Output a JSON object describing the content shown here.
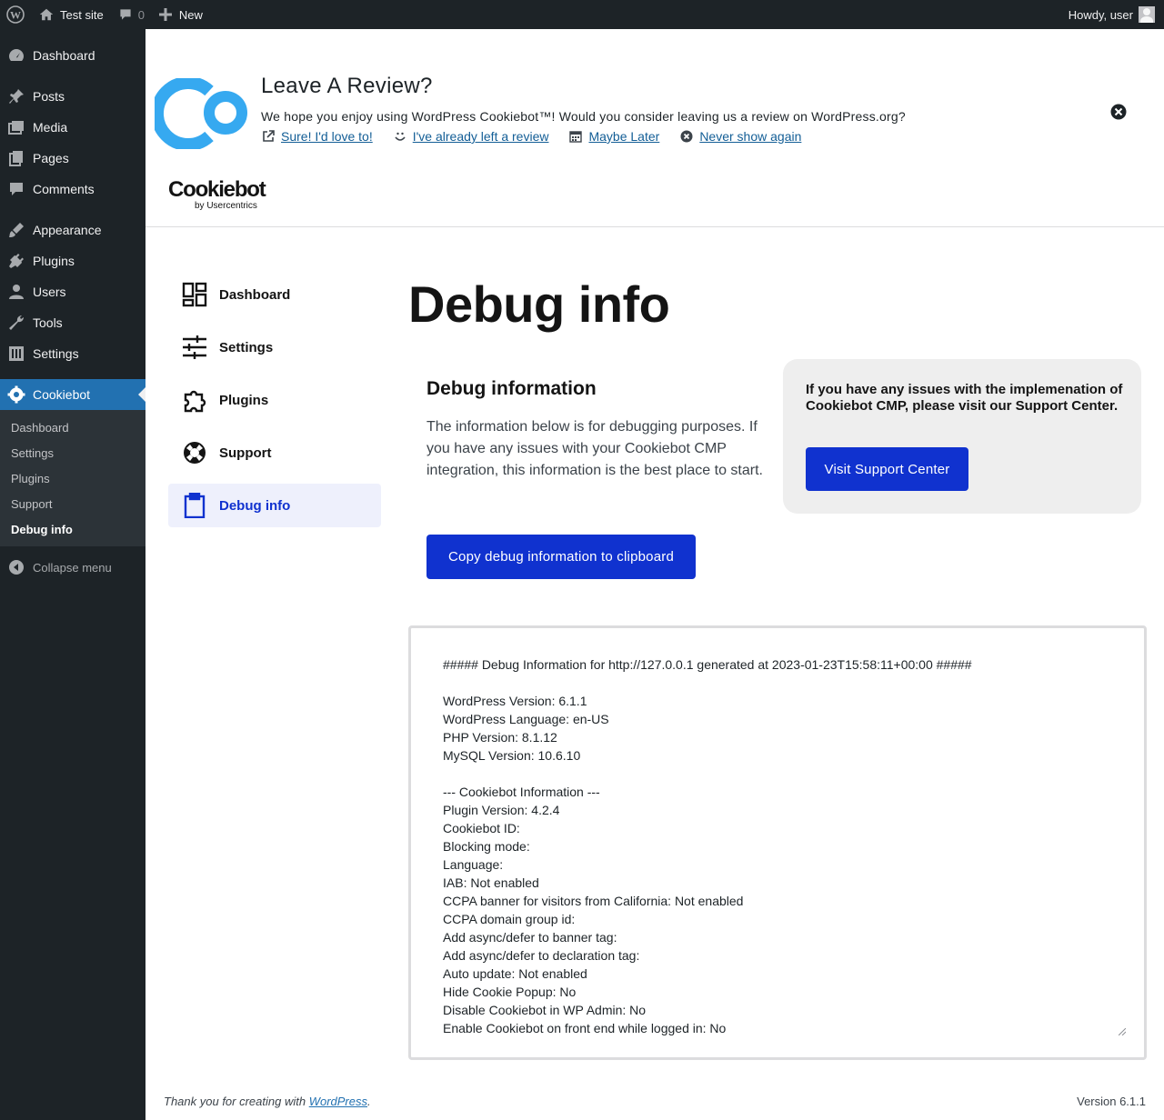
{
  "adminbar": {
    "site_name": "Test site",
    "comments_count": "0",
    "new_label": "New",
    "howdy": "Howdy, user"
  },
  "sidebar": {
    "items": [
      {
        "label": "Dashboard",
        "icon": "dashboard-icon"
      },
      {
        "label": "Posts",
        "icon": "pin-icon"
      },
      {
        "label": "Media",
        "icon": "media-icon"
      },
      {
        "label": "Pages",
        "icon": "pages-icon"
      },
      {
        "label": "Comments",
        "icon": "comment-icon"
      },
      {
        "label": "Appearance",
        "icon": "brush-icon"
      },
      {
        "label": "Plugins",
        "icon": "plug-icon"
      },
      {
        "label": "Users",
        "icon": "user-icon"
      },
      {
        "label": "Tools",
        "icon": "wrench-icon"
      },
      {
        "label": "Settings",
        "icon": "settings-icon"
      },
      {
        "label": "Cookiebot",
        "icon": "gear-icon"
      }
    ],
    "submenu": [
      "Dashboard",
      "Settings",
      "Plugins",
      "Support",
      "Debug info"
    ],
    "collapse_label": "Collapse menu"
  },
  "review": {
    "title": "Leave A Review?",
    "text": "We hope you enjoy using WordPress Cookiebot™! Would you consider leaving us a review on WordPress.org?",
    "links": [
      "Sure! I'd love to!",
      "I've already left a review",
      "Maybe Later",
      "Never show again"
    ]
  },
  "brand": {
    "name": "Cookiebot",
    "sub": "by Usercentrics"
  },
  "cb_nav": [
    "Dashboard",
    "Settings",
    "Plugins",
    "Support",
    "Debug info"
  ],
  "page_title": "Debug info",
  "debug": {
    "heading": "Debug information",
    "description": "The information below is for debugging purposes. If you have any issues with your Cookiebot CMP integration, this information is the best place to start.",
    "copy_button": "Copy debug information to clipboard",
    "lines": [
      "##### Debug Information for http://127.0.0.1 generated at 2023-01-23T15:58:11+00:00 #####",
      "",
      "WordPress Version: 6.1.1",
      "WordPress Language: en-US",
      "PHP Version: 8.1.12",
      "MySQL Version: 10.6.10",
      "",
      "--- Cookiebot Information ---",
      "Plugin Version: 4.2.4",
      "Cookiebot ID:",
      "Blocking mode:",
      "Language:",
      "IAB: Not enabled",
      "CCPA banner for visitors from California: Not enabled",
      "CCPA domain group id:",
      "Add async/defer to banner tag:",
      "Add async/defer to declaration tag:",
      "Auto update: Not enabled",
      "Hide Cookie Popup: No",
      "Disable Cookiebot in WP Admin: No",
      "Enable Cookiebot on front end while logged in: No"
    ]
  },
  "support": {
    "text": "If you have any issues with the implemenation of Cookiebot CMP, please visit our Support Center.",
    "button": "Visit Support Center"
  },
  "footer": {
    "thanks_prefix": "Thank you for creating with ",
    "thanks_link": "WordPress",
    "thanks_suffix": ".",
    "version": "Version 6.1.1"
  },
  "colors": {
    "admin_dark": "#1d2327",
    "wp_blue": "#2271b1",
    "cookiebot_blue": "#1032cf",
    "cookiebot_light_blue": "#36a9f0"
  }
}
